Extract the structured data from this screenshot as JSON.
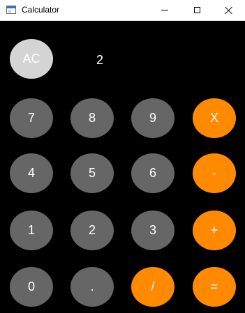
{
  "window": {
    "title": "Calculator"
  },
  "display": {
    "value": "2"
  },
  "keys": {
    "ac": "AC",
    "k7": "7",
    "k8": "8",
    "k9": "9",
    "mul": "X",
    "k4": "4",
    "k5": "5",
    "k6": "6",
    "sub": "-",
    "k1": "1",
    "k2": "2",
    "k3": "3",
    "add": "+",
    "k0": "0",
    "dot": ".",
    "div": "/",
    "eq": "="
  },
  "colors": {
    "background": "#000000",
    "digit_key": "#666666",
    "operator_key": "#ff8a00",
    "clear_key": "#d4d4d4"
  },
  "icons": {
    "app": "window-app-icon",
    "minimize": "minimize-icon",
    "maximize": "maximize-icon",
    "close": "close-icon"
  }
}
